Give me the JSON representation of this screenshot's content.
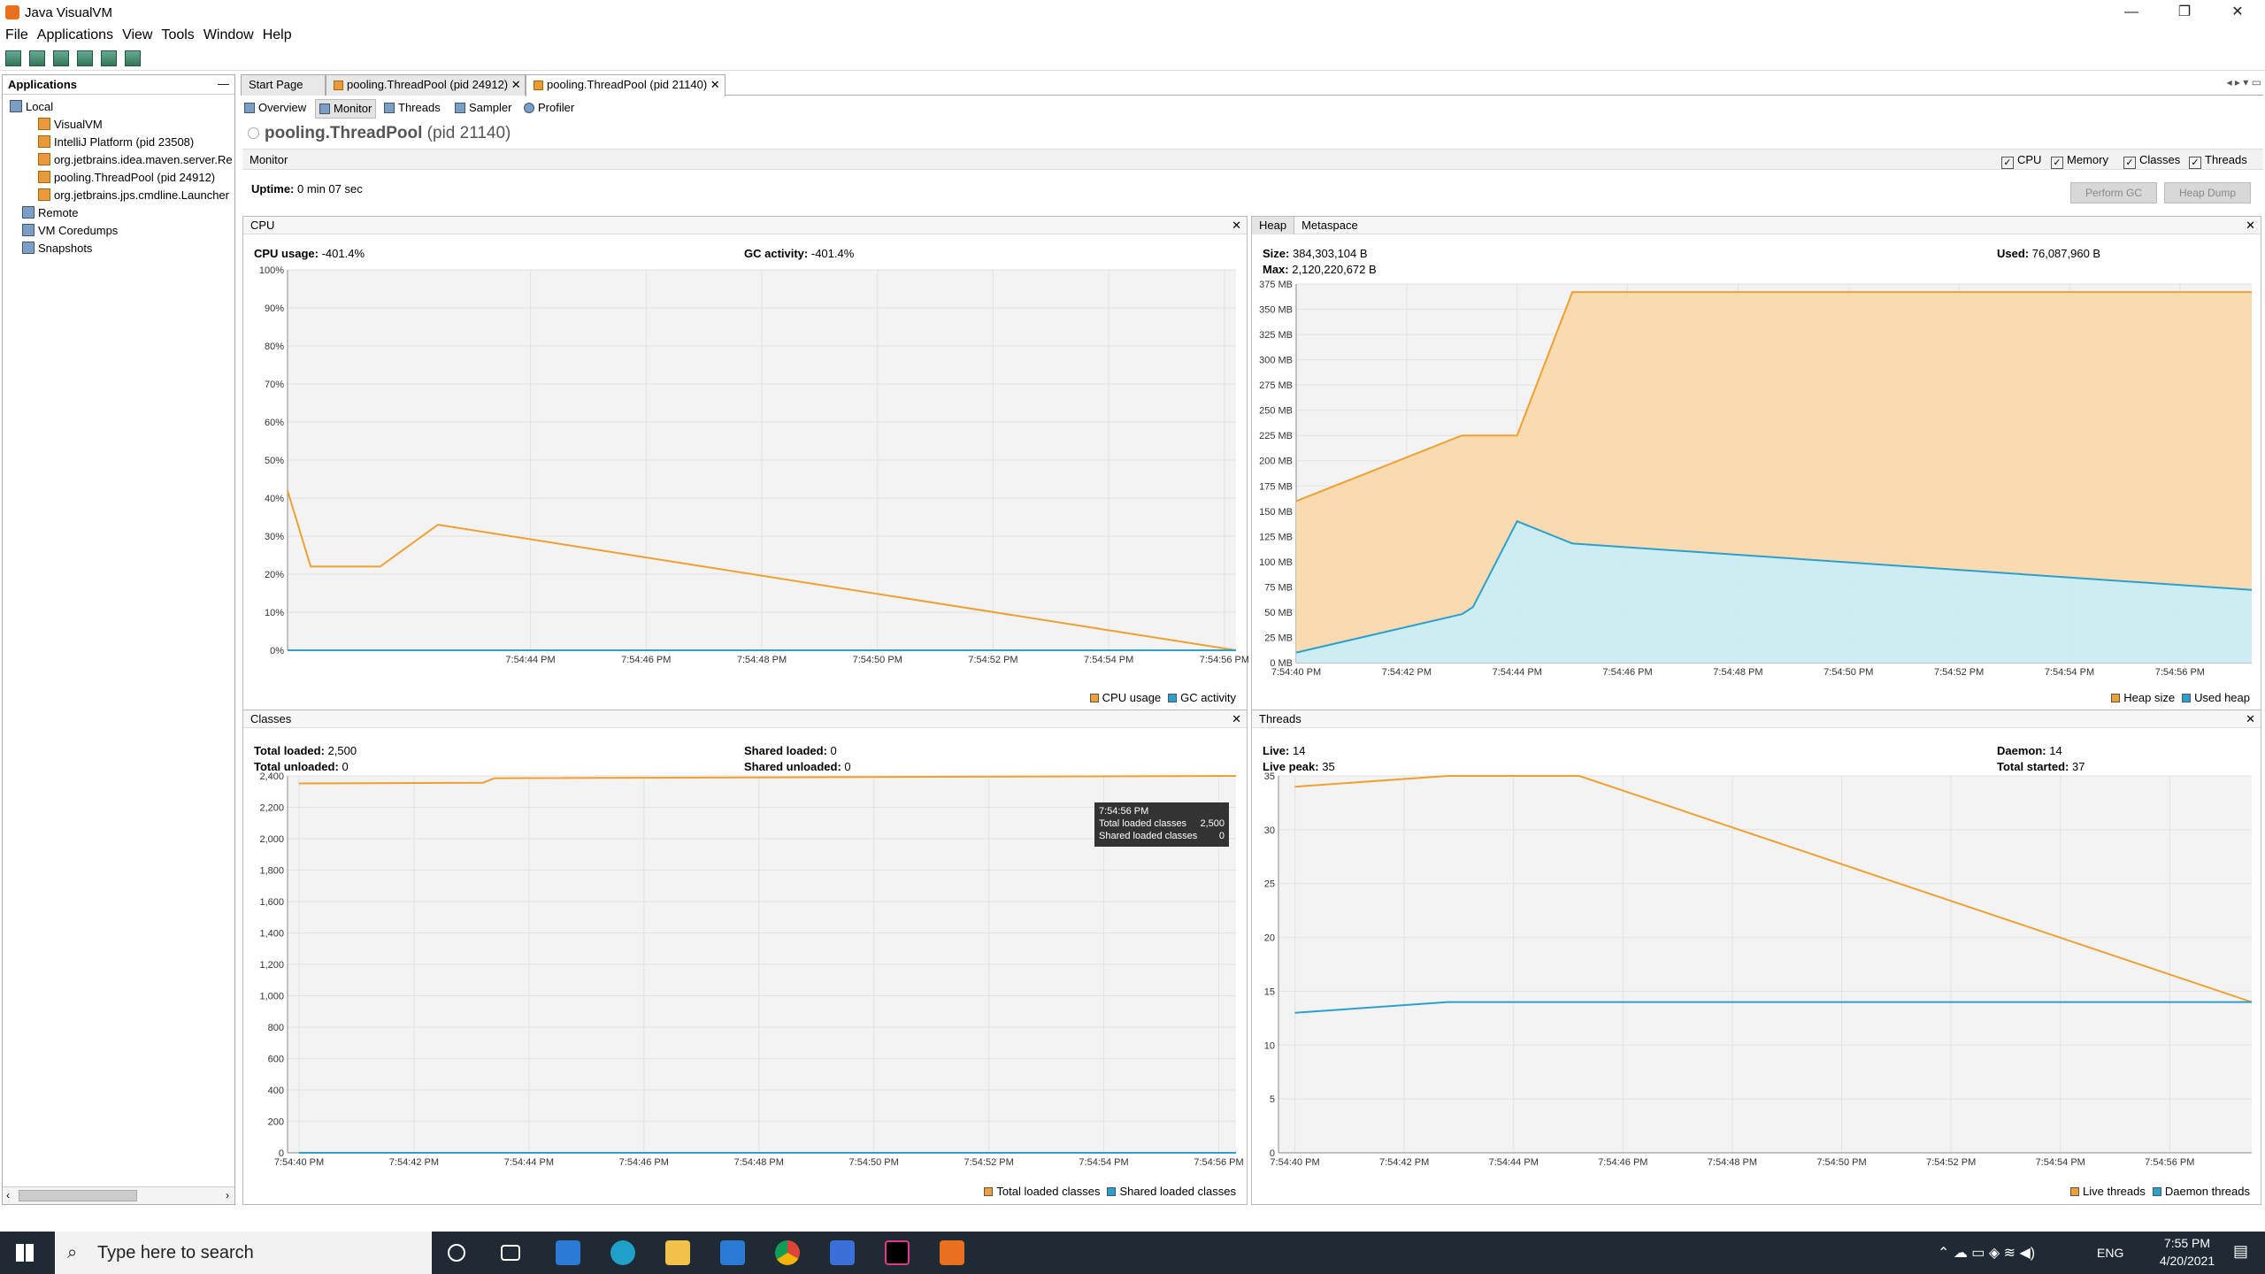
{
  "window": {
    "title": "Java VisualVM",
    "minimize": "—",
    "maximize": "❐",
    "close": "✕"
  },
  "menu": [
    "File",
    "Applications",
    "View",
    "Tools",
    "Window",
    "Help"
  ],
  "left": {
    "header": "Applications",
    "local": "Local",
    "visualvm": "VisualVM",
    "intellij": "IntelliJ Platform (pid 23508)",
    "maven": "org.jetbrains.idea.maven.server.Re",
    "pool": "pooling.ThreadPool (pid 24912)",
    "jps": "org.jetbrains.jps.cmdline.Launcher",
    "remote": "Remote",
    "coredumps": "VM Coredumps",
    "snapshots": "Snapshots"
  },
  "tabs": [
    "Start Page",
    "pooling.ThreadPool (pid 24912)",
    "pooling.ThreadPool (pid 21140)"
  ],
  "subtabs": [
    "Overview",
    "Monitor",
    "Threads",
    "Sampler",
    "Profiler"
  ],
  "app": {
    "name": "pooling.ThreadPool",
    "pid": "(pid 21140)"
  },
  "monitor": {
    "label": "Monitor",
    "checks": [
      "CPU",
      "Memory",
      "Classes",
      "Threads"
    ],
    "uptime_label": "Uptime:",
    "uptime": "0 min 07 sec",
    "perform_gc": "Perform GC",
    "heap_dump": "Heap Dump"
  },
  "cpu": {
    "title": "CPU",
    "usage_label": "CPU usage:",
    "usage": "-401.4%",
    "gc_label": "GC activity:",
    "gc": "-401.4%",
    "legend": [
      "CPU usage",
      "GC activity"
    ]
  },
  "heap": {
    "tab1": "Heap",
    "tab2": "Metaspace",
    "size_label": "Size:",
    "size": "384,303,104 B",
    "max_label": "Max:",
    "max": "2,120,220,672 B",
    "used_label": "Used:",
    "used": "76,087,960 B",
    "legend": [
      "Heap size",
      "Used heap"
    ]
  },
  "classes": {
    "title": "Classes",
    "tl_label": "Total loaded:",
    "tl": "2,500",
    "tu_label": "Total unloaded:",
    "tu": "0",
    "sl_label": "Shared loaded:",
    "sl": "0",
    "su_label": "Shared unloaded:",
    "su": "0",
    "legend": [
      "Total loaded classes",
      "Shared loaded classes"
    ],
    "tooltip": {
      "time": "7:54:56 PM",
      "r1": "Total loaded classes",
      "v1": "2,500",
      "r2": "Shared loaded classes",
      "v2": "0"
    }
  },
  "threads": {
    "title": "Threads",
    "live_label": "Live:",
    "live": "14",
    "peak_label": "Live peak:",
    "peak": "35",
    "daemon_label": "Daemon:",
    "daemon": "14",
    "started_label": "Total started:",
    "started": "37",
    "legend": [
      "Live threads",
      "Daemon threads"
    ]
  },
  "taskbar": {
    "search": "Type here to search",
    "lang": "ENG",
    "time": "7:55 PM",
    "date": "4/20/2021"
  },
  "colors": {
    "orange": "#f0a030",
    "blue": "#2aa0d0",
    "heapfill": "#fbd7a8",
    "usedfill": "#c8eefa"
  },
  "chart_data": [
    {
      "type": "line",
      "title": "CPU",
      "ylim": [
        0,
        100
      ],
      "yticks": [
        "0%",
        "10%",
        "20%",
        "30%",
        "40%",
        "50%",
        "60%",
        "70%",
        "80%",
        "90%",
        "100%"
      ],
      "xticks": [
        "7:54:44 PM",
        "7:54:46 PM",
        "7:54:48 PM",
        "7:54:50 PM",
        "7:54:52 PM",
        "7:54:54 PM",
        "7:54:56 PM"
      ],
      "x": [
        39.8,
        40.2,
        41.4,
        42.4,
        56.2
      ],
      "series": [
        {
          "name": "CPU usage",
          "values": [
            42,
            22,
            22,
            33,
            0
          ]
        },
        {
          "name": "GC activity",
          "values": [
            0,
            0,
            0,
            0,
            0
          ]
        }
      ]
    },
    {
      "type": "area",
      "title": "Heap",
      "ylim": [
        0,
        375
      ],
      "yticks": [
        "0 MB",
        "25 MB",
        "50 MB",
        "75 MB",
        "100 MB",
        "125 MB",
        "150 MB",
        "175 MB",
        "200 MB",
        "225 MB",
        "250 MB",
        "275 MB",
        "300 MB",
        "325 MB",
        "350 MB",
        "375 MB"
      ],
      "xticks": [
        "7:54:40 PM",
        "7:54:42 PM",
        "7:54:44 PM",
        "7:54:46 PM",
        "7:54:48 PM",
        "7:54:50 PM",
        "7:54:52 PM",
        "7:54:54 PM",
        "7:54:56 PM"
      ],
      "series": [
        {
          "name": "Heap size",
          "x": [
            40,
            43,
            44,
            45,
            57.3
          ],
          "values": [
            160,
            225,
            225,
            367,
            367
          ]
        },
        {
          "name": "Used heap",
          "x": [
            40,
            43,
            43.2,
            44,
            45,
            57.3
          ],
          "values": [
            10,
            48,
            55,
            140,
            118,
            72
          ]
        }
      ]
    },
    {
      "type": "line",
      "title": "Classes",
      "ylim": [
        0,
        2500
      ],
      "yticks": [
        "0",
        "200",
        "400",
        "600",
        "800",
        "1,000",
        "1,200",
        "1,400",
        "1,600",
        "1,800",
        "2,000",
        "2,200",
        "2,400"
      ],
      "xticks": [
        "7:54:40 PM",
        "7:54:42 PM",
        "7:54:44 PM",
        "7:54:46 PM",
        "7:54:48 PM",
        "7:54:50 PM",
        "7:54:52 PM",
        "7:54:54 PM",
        "7:54:56 PM"
      ],
      "series": [
        {
          "name": "Total loaded classes",
          "x": [
            40,
            43.2,
            43.4,
            56.3
          ],
          "values": [
            2450,
            2455,
            2485,
            2500
          ]
        },
        {
          "name": "Shared loaded classes",
          "x": [
            40,
            56.3
          ],
          "values": [
            0,
            0
          ]
        }
      ]
    },
    {
      "type": "line",
      "title": "Threads",
      "ylim": [
        0,
        35
      ],
      "yticks": [
        "0",
        "5",
        "10",
        "15",
        "20",
        "25",
        "30",
        "35"
      ],
      "xticks": [
        "7:54:40 PM",
        "7:54:42 PM",
        "7:54:44 PM",
        "7:54:46 PM",
        "7:54:48 PM",
        "7:54:50 PM",
        "7:54:52 PM",
        "7:54:54 PM",
        "7:54:56 PM"
      ],
      "series": [
        {
          "name": "Live threads",
          "x": [
            40,
            42.8,
            45.2,
            57.5
          ],
          "values": [
            34,
            35,
            35,
            14
          ]
        },
        {
          "name": "Daemon threads",
          "x": [
            40,
            42.8,
            57.5
          ],
          "values": [
            13,
            14,
            14
          ]
        }
      ]
    }
  ]
}
